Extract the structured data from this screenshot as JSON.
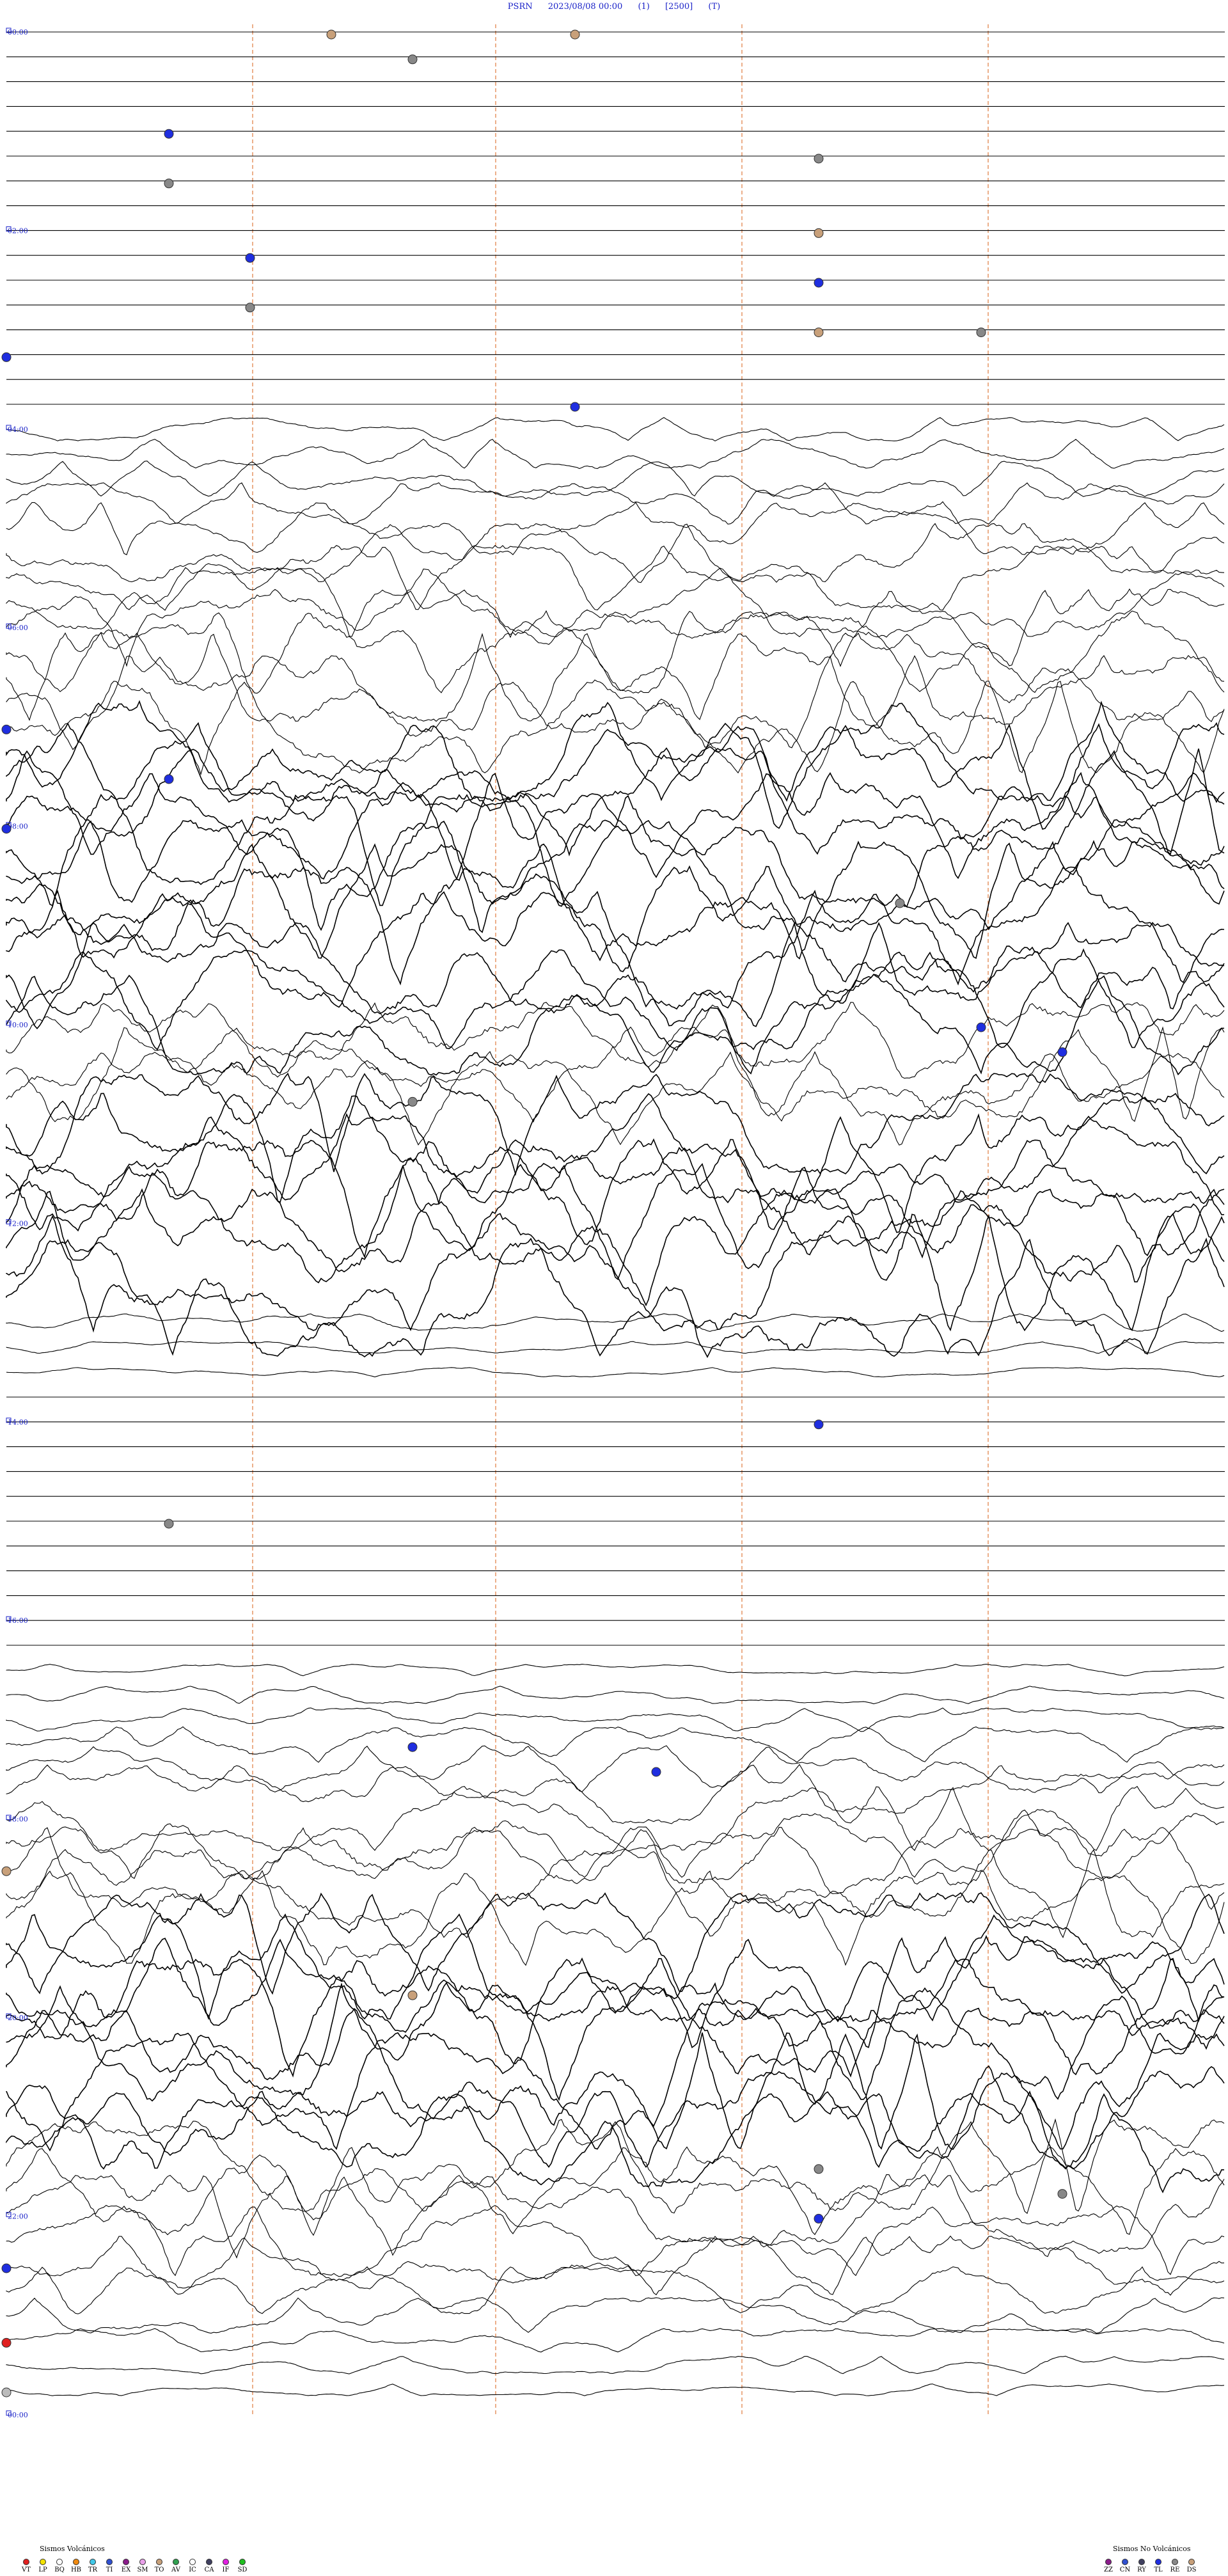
{
  "header": {
    "station": "PSRN",
    "datetime": "2023/08/08 00:00",
    "field1": "(1)",
    "scale": "[2500]",
    "field3": "(T)"
  },
  "chart_data": {
    "type": "seismogram",
    "station": "PSRN",
    "start": "2023/08/08 00:00",
    "hour_labels": [
      "00:00",
      "02:00",
      "04:00",
      "06:00",
      "08:00",
      "10:00",
      "12:00",
      "14:00",
      "16:00",
      "18:00",
      "20:00",
      "22:00",
      "00:00"
    ],
    "rows_per_hour": 4,
    "total_rows": 96,
    "activity_profile": [
      0.05,
      0.05,
      0.05,
      0.05,
      0.05,
      0.05,
      0.05,
      0.05,
      0.05,
      0.05,
      0.05,
      0.05,
      0.05,
      0.05,
      0.05,
      0.05,
      0.2,
      0.25,
      0.3,
      0.35,
      0.45,
      0.5,
      0.55,
      0.6,
      0.65,
      0.7,
      0.75,
      0.8,
      0.8,
      0.85,
      0.9,
      0.9,
      0.9,
      0.95,
      0.95,
      1.0,
      1.0,
      1.0,
      0.9,
      0.85,
      0.85,
      0.8,
      0.8,
      0.8,
      0.85,
      0.95,
      1.0,
      1.0,
      1.0,
      1.0,
      1.0,
      1.0,
      0.15,
      0.1,
      0.08,
      0.05,
      0.05,
      0.05,
      0.05,
      0.05,
      0.05,
      0.05,
      0.05,
      0.05,
      0.05,
      0.05,
      0.1,
      0.15,
      0.2,
      0.3,
      0.4,
      0.5,
      0.55,
      0.6,
      0.7,
      0.75,
      0.8,
      0.85,
      0.9,
      0.95,
      1.0,
      1.0,
      1.0,
      1.0,
      0.9,
      0.85,
      0.8,
      0.75,
      0.7,
      0.6,
      0.5,
      0.4,
      0.3,
      0.2,
      0.15,
      0.1
    ],
    "events": [
      {
        "minute": 4,
        "color": "#c8a07a"
      },
      {
        "minute": 7,
        "color": "#c8a07a"
      },
      {
        "minute": 20,
        "color": "#888888"
      },
      {
        "minute": 62,
        "color": "#1f2ee0"
      },
      {
        "minute": 85,
        "color": "#888888"
      },
      {
        "minute": 92,
        "color": "#888888"
      },
      {
        "minute": 130,
        "color": "#c8a07a"
      },
      {
        "minute": 138,
        "color": "#1f2ee0"
      },
      {
        "minute": 160,
        "color": "#1f2ee0"
      },
      {
        "minute": 168,
        "color": "#888888"
      },
      {
        "minute": 190,
        "color": "#c8a07a"
      },
      {
        "minute": 192,
        "color": "#888888"
      },
      {
        "minute": 195,
        "color": "#1f2ee0"
      },
      {
        "minute": 232,
        "color": "#1f2ee0"
      },
      {
        "minute": 420,
        "color": "#1f2ee0"
      },
      {
        "minute": 452,
        "color": "#1f2ee0"
      },
      {
        "minute": 480,
        "color": "#1f2ee0"
      },
      {
        "minute": 536,
        "color": "#888888"
      },
      {
        "minute": 612,
        "color": "#1f2ee0"
      },
      {
        "minute": 628,
        "color": "#1f2ee0"
      },
      {
        "minute": 650,
        "color": "#888888"
      },
      {
        "minute": 850,
        "color": "#1f2ee0"
      },
      {
        "minute": 902,
        "color": "#888888"
      },
      {
        "minute": 1040,
        "color": "#1f2ee0"
      },
      {
        "minute": 1058,
        "color": "#1f2ee0"
      },
      {
        "minute": 1110,
        "color": "#c8a07a"
      },
      {
        "minute": 1190,
        "color": "#c8a07a"
      },
      {
        "minute": 1300,
        "color": "#888888"
      },
      {
        "minute": 1318,
        "color": "#888888"
      },
      {
        "minute": 1330,
        "color": "#1f2ee0"
      },
      {
        "minute": 1350,
        "color": "#1f2ee0"
      },
      {
        "minute": 1395,
        "color": "#e02020"
      },
      {
        "minute": 1425,
        "color": "#bbbbbb"
      }
    ],
    "line_color": "#000000",
    "grid_color": "#e07a3c",
    "label_color": "#1a22c8"
  },
  "legend": {
    "volcanic_title": "Sismos Volcánicos",
    "volcanic": [
      {
        "code": "VT",
        "color": "#e02020"
      },
      {
        "code": "LP",
        "color": "#f2e200"
      },
      {
        "code": "BQ",
        "color": "#ffffff"
      },
      {
        "code": "HB",
        "color": "#f08a10"
      },
      {
        "code": "TR",
        "color": "#40c8e8"
      },
      {
        "code": "TI",
        "color": "#3050d0"
      },
      {
        "code": "EX",
        "color": "#8a1c8a"
      },
      {
        "code": "SM",
        "color": "#e8a0e8"
      },
      {
        "code": "TO",
        "color": "#c8a07a"
      },
      {
        "code": "AV",
        "color": "#30a050"
      },
      {
        "code": "IC",
        "color": "#ffffff"
      },
      {
        "code": "CA",
        "color": "#404060"
      },
      {
        "code": "IF",
        "color": "#e020e0"
      },
      {
        "code": "SD",
        "color": "#20c020"
      }
    ],
    "nonvolcanic_title": "Sismos No Volcánicos",
    "nonvolcanic": [
      {
        "code": "ZZ",
        "color": "#8a1c8a"
      },
      {
        "code": "CN",
        "color": "#3050d0"
      },
      {
        "code": "RY",
        "color": "#404060"
      },
      {
        "code": "TL",
        "color": "#1f2ee0"
      },
      {
        "code": "RE",
        "color": "#888888"
      },
      {
        "code": "DS",
        "color": "#c8a07a"
      }
    ]
  }
}
